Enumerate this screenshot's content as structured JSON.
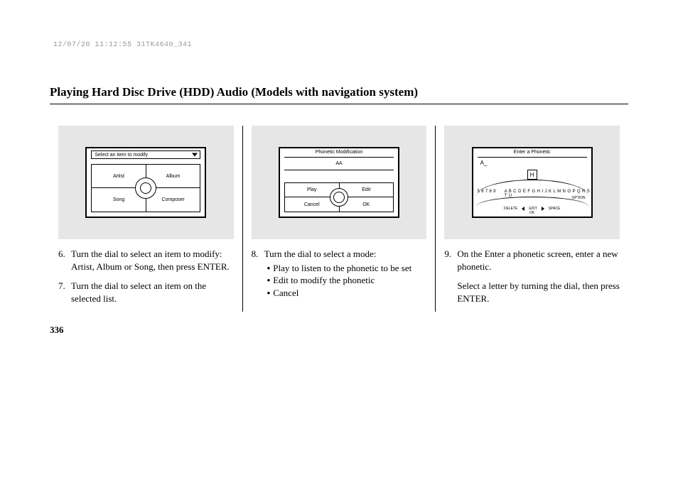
{
  "header_stamp": "12/07/20 11:12:55 31TK4640_341",
  "title": "Playing Hard Disc Drive (HDD) Audio (Models with navigation system)",
  "page_number": "336",
  "col1": {
    "screen": {
      "title": "Select an item to modify",
      "cells": {
        "tl": "Artist",
        "tr": "Album",
        "bl": "Song",
        "br": "Composer"
      }
    },
    "steps": [
      {
        "num": "6.",
        "text": "Turn the dial to select an item to modify: Artist, Album or Song, then press ENTER."
      },
      {
        "num": "7.",
        "text": "Turn the dial to select an item on the selected list."
      }
    ]
  },
  "col2": {
    "screen": {
      "title": "Phonetic Modification",
      "value": "AA",
      "cells": {
        "tl": "Play",
        "tr": "Edit",
        "bl": "Cancel",
        "br": "OK"
      }
    },
    "steps": [
      {
        "num": "8.",
        "text": "Turn the dial to select a mode:",
        "bullets": [
          "Play to listen to the phonetic to be set",
          "Edit to modify the phonetic",
          "Cancel"
        ]
      }
    ]
  },
  "col3": {
    "screen": {
      "title": "Enter a Phonetic",
      "value": "A_",
      "highlight": "H",
      "nums": "5 6 7 8 9",
      "alpha": "A B C D E F G H I J K L M N O P Q R S T U",
      "option": "OPTION",
      "delete": "DELETE",
      "edit": "EDIT",
      "space": "SPACE",
      "ok": "OK"
    },
    "steps": [
      {
        "num": "9.",
        "text": "On the Enter a phonetic screen, enter a new phonetic."
      }
    ],
    "note": "Select a letter by turning the dial, then press ENTER."
  }
}
